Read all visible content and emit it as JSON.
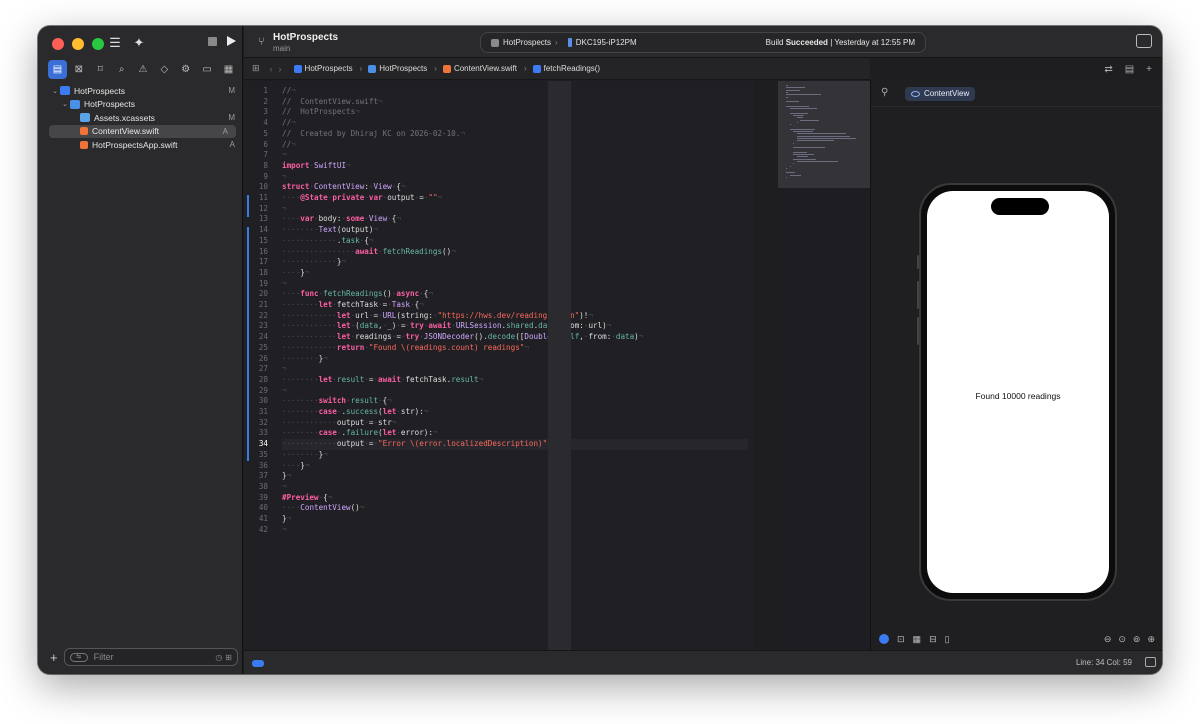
{
  "sidebar": {
    "items": [
      {
        "label": "HotProspects",
        "status": "M",
        "kind": "project"
      },
      {
        "label": "HotProspects",
        "status": "",
        "kind": "folder"
      },
      {
        "label": "Assets.xcassets",
        "status": "M",
        "kind": "assets"
      },
      {
        "label": "ContentView.swift",
        "status": "A",
        "kind": "swift",
        "selected": true
      },
      {
        "label": "HotProspectsApp.swift",
        "status": "A",
        "kind": "swift"
      }
    ],
    "filter_placeholder": "Filter"
  },
  "toolbar": {
    "project_name": "HotProspects",
    "branch": "main",
    "scheme": "HotProspects",
    "destination": "DKC195-iP12PM",
    "build_prefix": "Build",
    "build_result": "Succeeded",
    "build_time": "| Yesterday at 12:55 PM"
  },
  "jumpbar": {
    "crumbs": [
      "HotProspects",
      "HotProspects",
      "ContentView.swift",
      "fetchReadings()"
    ]
  },
  "editor": {
    "current_line": 34,
    "lines": [
      "//",
      "//  ContentView.swift",
      "//  HotProspects",
      "//",
      "//  Created by Dhiraj KC on 2026-02-10.",
      "//",
      "",
      "import SwiftUI",
      "",
      "struct ContentView: View {",
      "    @State private var output = \"\"",
      "",
      "    var body: some View {",
      "        Text(output)",
      "            .task {",
      "                await fetchReadings()",
      "            }",
      "    }",
      "",
      "    func fetchReadings() async {",
      "        let fetchTask = Task {",
      "            let url = URL(string: \"https://hws.dev/readings.json\")!",
      "            let (data, _) = try await URLSession.shared.data(from: url)",
      "            let readings = try JSONDecoder().decode([Double].self, from: data)",
      "            return \"Found \\(readings.count) readings\"",
      "        }",
      "",
      "        let result = await fetchTask.result",
      "",
      "        switch result {",
      "        case .success(let str):",
      "            output = str",
      "        case .failure(let error):",
      "            output = \"Error \\(error.localizedDescription)\"",
      "        }",
      "    }",
      "}",
      "",
      "#Preview {",
      "    ContentView()",
      "}",
      ""
    ]
  },
  "canvas": {
    "tab_label": "ContentView",
    "preview_text": "Found 10000 readings"
  },
  "statusbar": {
    "line_col": "Line: 34  Col: 59"
  },
  "colors": {
    "accent": "#3a7bf2",
    "traffic_red": "#ff5f57",
    "traffic_yellow": "#febc2e",
    "traffic_green": "#28c840"
  }
}
